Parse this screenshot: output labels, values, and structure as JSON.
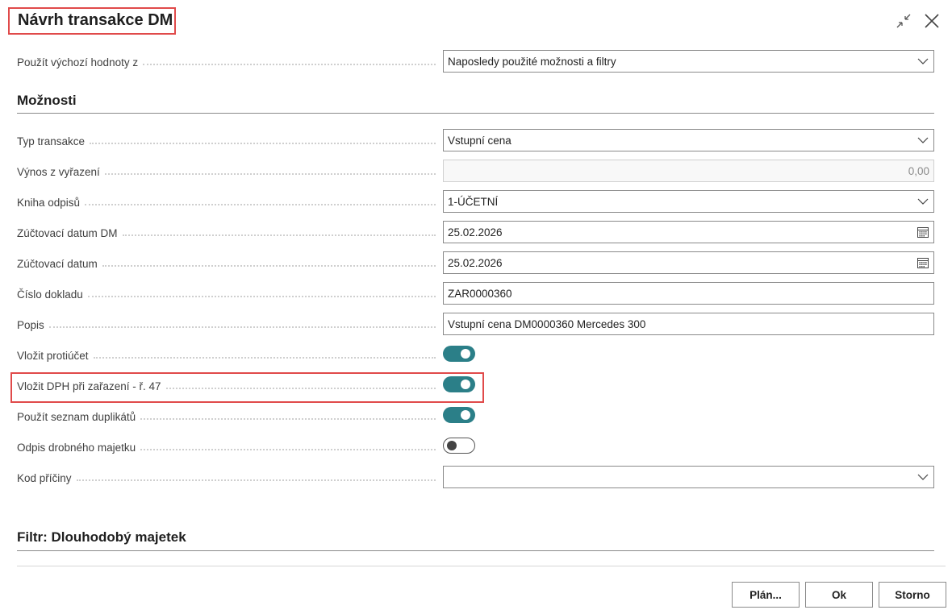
{
  "dialog": {
    "title": "Návrh transakce DM"
  },
  "defaults": {
    "label": "Použít výchozí hodnoty z",
    "value": "Naposledy použité možnosti a filtry"
  },
  "options": {
    "section_title": "Možnosti",
    "transaction_type": {
      "label": "Typ transakce",
      "value": "Vstupní cena"
    },
    "disposal_proceeds": {
      "label": "Výnos z vyřazení",
      "value": "0,00"
    },
    "depreciation_book": {
      "label": "Kniha odpisů",
      "value": "1-ÚČETNÍ"
    },
    "fa_posting_date": {
      "label": "Zúčtovací datum DM",
      "value": "25.02.2026"
    },
    "posting_date": {
      "label": "Zúčtovací datum",
      "value": "25.02.2026"
    },
    "document_no": {
      "label": "Číslo dokladu",
      "value": "ZAR0000360"
    },
    "description": {
      "label": "Popis",
      "value": "Vstupní cena DM0000360 Mercedes 300"
    },
    "insert_bal_account": {
      "label": "Vložit protiúčet",
      "on": true
    },
    "insert_vat": {
      "label": "Vložit DPH při zařazení - ř. 47",
      "on": true
    },
    "use_duplication_list": {
      "label": "Použít seznam duplikátů",
      "on": true
    },
    "small_asset_depreciation": {
      "label": "Odpis drobného majetku",
      "on": false
    },
    "reason_code": {
      "label": "Kod příčiny",
      "value": ""
    }
  },
  "filter": {
    "section_title": "Filtr: Dlouhodobý majetek"
  },
  "buttons": {
    "plan": "Plán...",
    "ok": "Ok",
    "cancel": "Storno"
  },
  "colors": {
    "highlight": "#e04a4a",
    "toggle_on": "#2b7f88"
  },
  "icons": {
    "collapse": "collapse-icon",
    "close": "close-icon",
    "dropdown": "chevron-down-icon",
    "calendar": "calendar-icon"
  }
}
